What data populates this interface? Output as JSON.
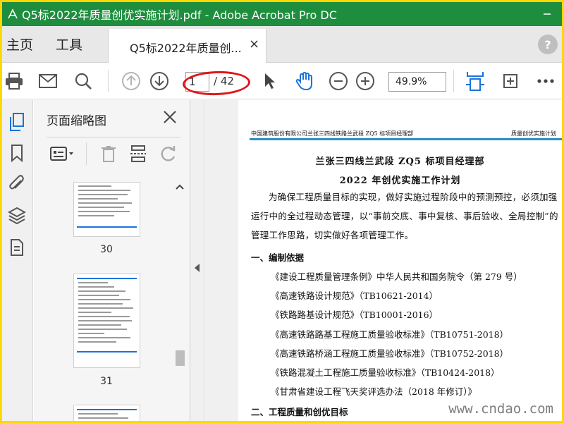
{
  "window": {
    "title": "Q5标2022年质量创优实施计划.pdf - Adobe Acrobat Pro DC"
  },
  "tabs": {
    "home": "主页",
    "tools": "工具",
    "document": "Q5标2022年质量创...",
    "close": "×",
    "help": "?"
  },
  "toolbar": {
    "current_page": "1",
    "page_total": "/ 42",
    "zoom": "49.9%",
    "icons": [
      "print-icon",
      "email-icon",
      "search-icon",
      "prev-page-icon",
      "next-page-icon",
      "select-cursor-icon",
      "hand-tool-icon",
      "zoom-out-icon",
      "zoom-in-icon",
      "fit-width-icon",
      "rotate-icon",
      "more-icon"
    ]
  },
  "left_strip": {
    "icons": [
      "pages-icon",
      "bookmark-icon",
      "attachment-icon",
      "layers-icon",
      "document-properties-icon"
    ]
  },
  "thumbnails_panel": {
    "title": "页面缩略图",
    "pages": [
      {
        "number": "30"
      },
      {
        "number": "31"
      },
      {
        "number": ""
      }
    ]
  },
  "document": {
    "header_left": "中国建筑股份有限公司兰张三四线铁路兰武段 ZQ5 标项目经理部",
    "header_right": "质量创优实施计划",
    "title_line1": "兰张三四线兰武段 ZQ5 标项目经理部",
    "title_line2": "2022 年创优实施工作计划",
    "intro": "为确保工程质量目标的实现，做好实施过程阶段中的预测预控，必须加强运行中的全过程动态管理，以“事前交底、事中复核、事后验收、全局控制”的管理工作思路，切实做好各项管理工作。",
    "section1": "一、编制依据",
    "references": [
      "《建设工程质量管理条例》中华人民共和国务院令（第 279 号）",
      "《高速铁路设计规范》（TB10621-2014）",
      "《铁路路基设计规范》（TB10001-2016）",
      "《高速铁路路基工程施工质量验收标准》（TB10751-2018）",
      "《高速铁路桥涵工程施工质量验收标准》（TB10752-2018）",
      "《铁路混凝土工程施工质量验收标准》（TB10424-2018）",
      "《甘肃省建设工程飞天奖评选办法（2018 年修订）》"
    ],
    "section2": "二、工程质量和创优目标"
  },
  "watermark": "www.cndao.com",
  "colors": {
    "titlebar": "#1e8e3e",
    "accent": "#1a73d9",
    "highlight": "#e0161b",
    "frame": "#ffd800"
  }
}
